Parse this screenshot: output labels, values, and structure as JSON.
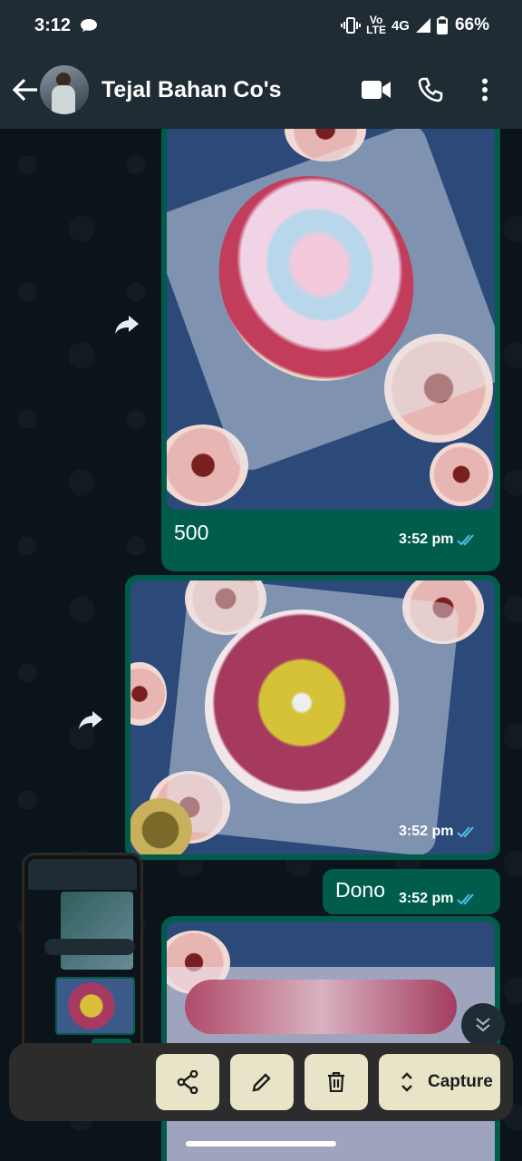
{
  "status_bar": {
    "time": "3:12",
    "network_top": "Vo",
    "network_bottom": "LTE",
    "network_type": "4G",
    "battery": "66%"
  },
  "header": {
    "contact_name": "Tejal Bahan Co's",
    "icons": [
      "back-arrow-icon",
      "video-call-icon",
      "voice-call-icon",
      "more-options-icon"
    ]
  },
  "messages": [
    {
      "type": "image",
      "caption": "500",
      "time": "3:52 pm",
      "status": "read"
    },
    {
      "type": "image",
      "caption": "",
      "time": "3:52 pm",
      "status": "read"
    },
    {
      "type": "text",
      "text": "Dono",
      "time": "3:52 pm",
      "status": "read"
    },
    {
      "type": "image",
      "caption": "",
      "time": "",
      "status": ""
    }
  ],
  "action_bar": {
    "capture_label": "Capture",
    "buttons": [
      "share-icon",
      "edit-icon",
      "delete-icon",
      "expand-icon"
    ]
  },
  "colors": {
    "header_bg": "#1f2c34",
    "chat_bg": "#0b141a",
    "outgoing_bubble": "#005c4b",
    "read_tick": "#53bdeb",
    "action_button_bg": "#e8e4c8"
  }
}
